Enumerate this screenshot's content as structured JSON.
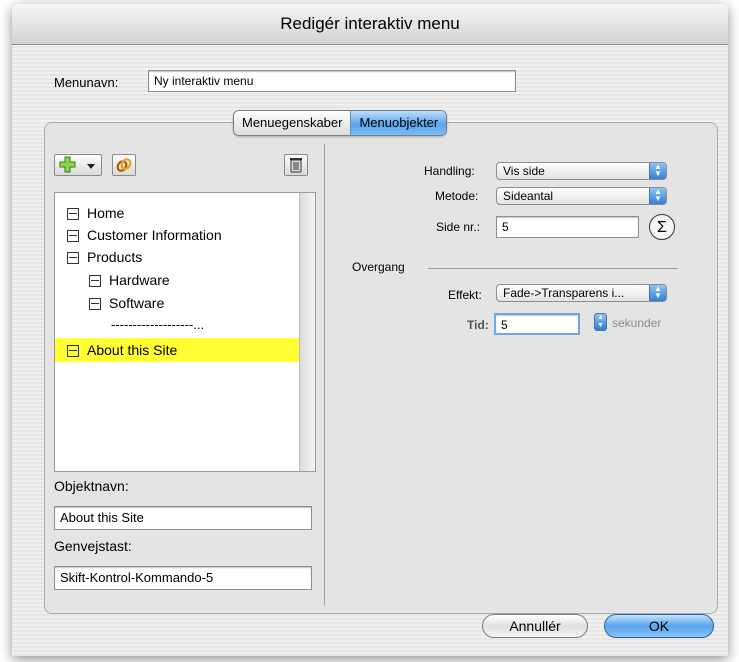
{
  "window": {
    "title": "Redigér interaktiv menu"
  },
  "menu_name": {
    "label": "Menunavn:",
    "value": "Ny interaktiv menu"
  },
  "tabs": [
    {
      "label": "Menuegenskaber",
      "active": false
    },
    {
      "label": "Menuobjekter",
      "active": true
    }
  ],
  "toolbar": {
    "add_icon": "plus-icon",
    "dropdown_icon": "chevron-down-icon",
    "link_icon": "chain-icon",
    "delete_icon": "trash-icon"
  },
  "tree": {
    "items": [
      {
        "label": "Home",
        "level": 0,
        "selected": false
      },
      {
        "label": "Customer Information",
        "level": 0,
        "selected": false
      },
      {
        "label": "Products",
        "level": 0,
        "selected": false
      },
      {
        "label": "Hardware",
        "level": 1,
        "selected": false
      },
      {
        "label": "Software",
        "level": 1,
        "selected": false
      },
      {
        "label": "-------------------...",
        "level": 1,
        "selected": false,
        "separator": true
      },
      {
        "label": "About this Site",
        "level": 0,
        "selected": true
      }
    ]
  },
  "object_name": {
    "label": "Objektnavn:",
    "value": "About this Site"
  },
  "shortcut": {
    "label": "Genvejstast:",
    "value": "Skift-Kontrol-Kommando-5"
  },
  "action": {
    "handling_label": "Handling:",
    "handling_value": "Vis side",
    "metode_label": "Metode:",
    "metode_value": "Sideantal",
    "side_label": "Side nr.:",
    "side_value": "5",
    "sigma_icon": "sigma-icon"
  },
  "transition": {
    "section_label": "Overgang",
    "effekt_label": "Effekt:",
    "effekt_value": "Fade->Transparens i...",
    "tid_label": "Tid:",
    "tid_value": "5",
    "tid_unit": "sekunder"
  },
  "buttons": {
    "cancel": "Annullér",
    "ok": "OK"
  },
  "colors": {
    "selection": "#ffff33",
    "aqua": "#5aa4ea"
  }
}
